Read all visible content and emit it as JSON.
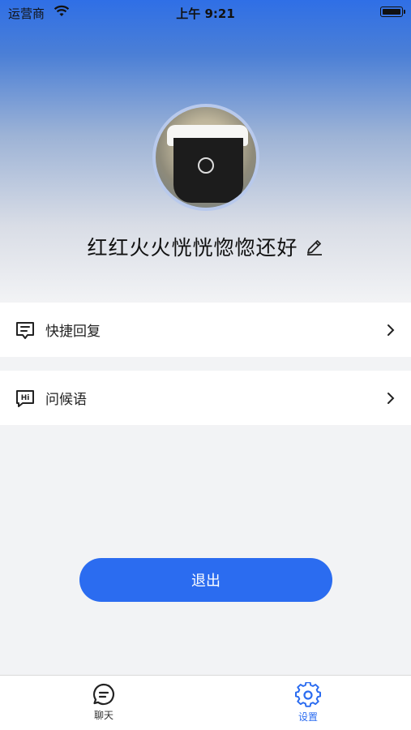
{
  "status_bar": {
    "carrier": "运营商",
    "time": "上午 9:21"
  },
  "profile": {
    "username": "红红火火恍恍惚惚还好"
  },
  "menu": [
    {
      "label": "快捷回复",
      "icon": "quick-reply-icon"
    },
    {
      "label": "问候语",
      "icon": "hi-greeting-icon"
    }
  ],
  "logout_label": "退出",
  "tabbar": {
    "tabs": [
      {
        "label": "聊天",
        "icon": "chat-icon",
        "active": false
      },
      {
        "label": "设置",
        "icon": "settings-gear-icon",
        "active": true
      }
    ]
  },
  "colors": {
    "accent": "#2b6cf0",
    "background": "#f2f3f5",
    "header_top": "#2f6fe6"
  }
}
